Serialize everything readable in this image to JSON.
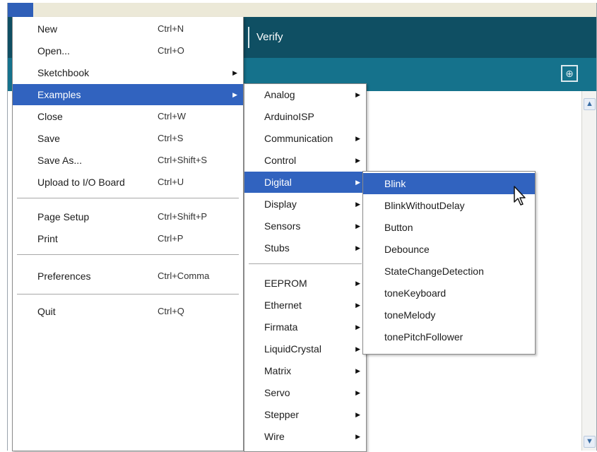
{
  "window": {
    "toolbar": {
      "verify_label": "Verify"
    },
    "tab_button_icon": "new-tab-icon",
    "scroll_up_icon": "scroll-up-arrow-icon",
    "scroll_down_icon": "scroll-down-arrow-icon"
  },
  "file_menu": {
    "items": [
      {
        "label": "New",
        "shortcut": "Ctrl+N"
      },
      {
        "label": "Open...",
        "shortcut": "Ctrl+O"
      },
      {
        "label": "Sketchbook",
        "submenu": true
      },
      {
        "label": "Examples",
        "submenu": true,
        "highlighted": true
      },
      {
        "label": "Close",
        "shortcut": "Ctrl+W"
      },
      {
        "label": "Save",
        "shortcut": "Ctrl+S"
      },
      {
        "label": "Save As...",
        "shortcut": "Ctrl+Shift+S"
      },
      {
        "label": "Upload to I/O Board",
        "shortcut": "Ctrl+U"
      },
      {
        "label": "Page Setup",
        "shortcut": "Ctrl+Shift+P"
      },
      {
        "label": "Print",
        "shortcut": "Ctrl+P"
      },
      {
        "label": "Preferences",
        "shortcut": "Ctrl+Comma"
      },
      {
        "label": "Quit",
        "shortcut": "Ctrl+Q"
      }
    ]
  },
  "examples_menu": {
    "items": [
      {
        "label": "Analog",
        "submenu": true
      },
      {
        "label": "ArduinoISP"
      },
      {
        "label": "Communication",
        "submenu": true
      },
      {
        "label": "Control",
        "submenu": true
      },
      {
        "label": "Digital",
        "submenu": true,
        "highlighted": true
      },
      {
        "label": "Display",
        "submenu": true
      },
      {
        "label": "Sensors",
        "submenu": true
      },
      {
        "label": "Stubs",
        "submenu": true
      },
      {
        "label": "EEPROM",
        "submenu": true
      },
      {
        "label": "Ethernet",
        "submenu": true
      },
      {
        "label": "Firmata",
        "submenu": true
      },
      {
        "label": "LiquidCrystal",
        "submenu": true
      },
      {
        "label": "Matrix",
        "submenu": true
      },
      {
        "label": "Servo",
        "submenu": true
      },
      {
        "label": "Stepper",
        "submenu": true
      },
      {
        "label": "Wire",
        "submenu": true
      }
    ]
  },
  "digital_menu": {
    "items": [
      {
        "label": "Blink",
        "highlighted": true
      },
      {
        "label": "BlinkWithoutDelay"
      },
      {
        "label": "Button"
      },
      {
        "label": "Debounce"
      },
      {
        "label": "StateChangeDetection"
      },
      {
        "label": "toneKeyboard"
      },
      {
        "label": "toneMelody"
      },
      {
        "label": "tonePitchFollower"
      }
    ]
  },
  "colors": {
    "toolbar": "#0f4f63",
    "tabbar": "#15728c",
    "highlight": "#3163bf"
  }
}
